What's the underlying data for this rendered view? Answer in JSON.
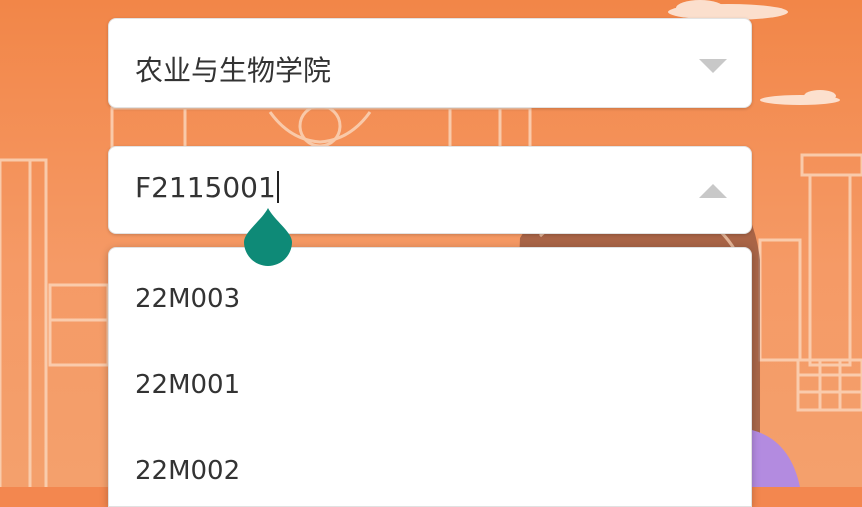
{
  "college_select": {
    "value": "农业与生物学院",
    "icon": "chevron-down-icon"
  },
  "class_input": {
    "value": "F2115001",
    "icon": "chevron-up-icon"
  },
  "dropdown": {
    "options": [
      "22M003",
      "22M001",
      "22M002"
    ]
  },
  "colors": {
    "background": "#f3874f",
    "selection_handle": "#0e8a77"
  }
}
